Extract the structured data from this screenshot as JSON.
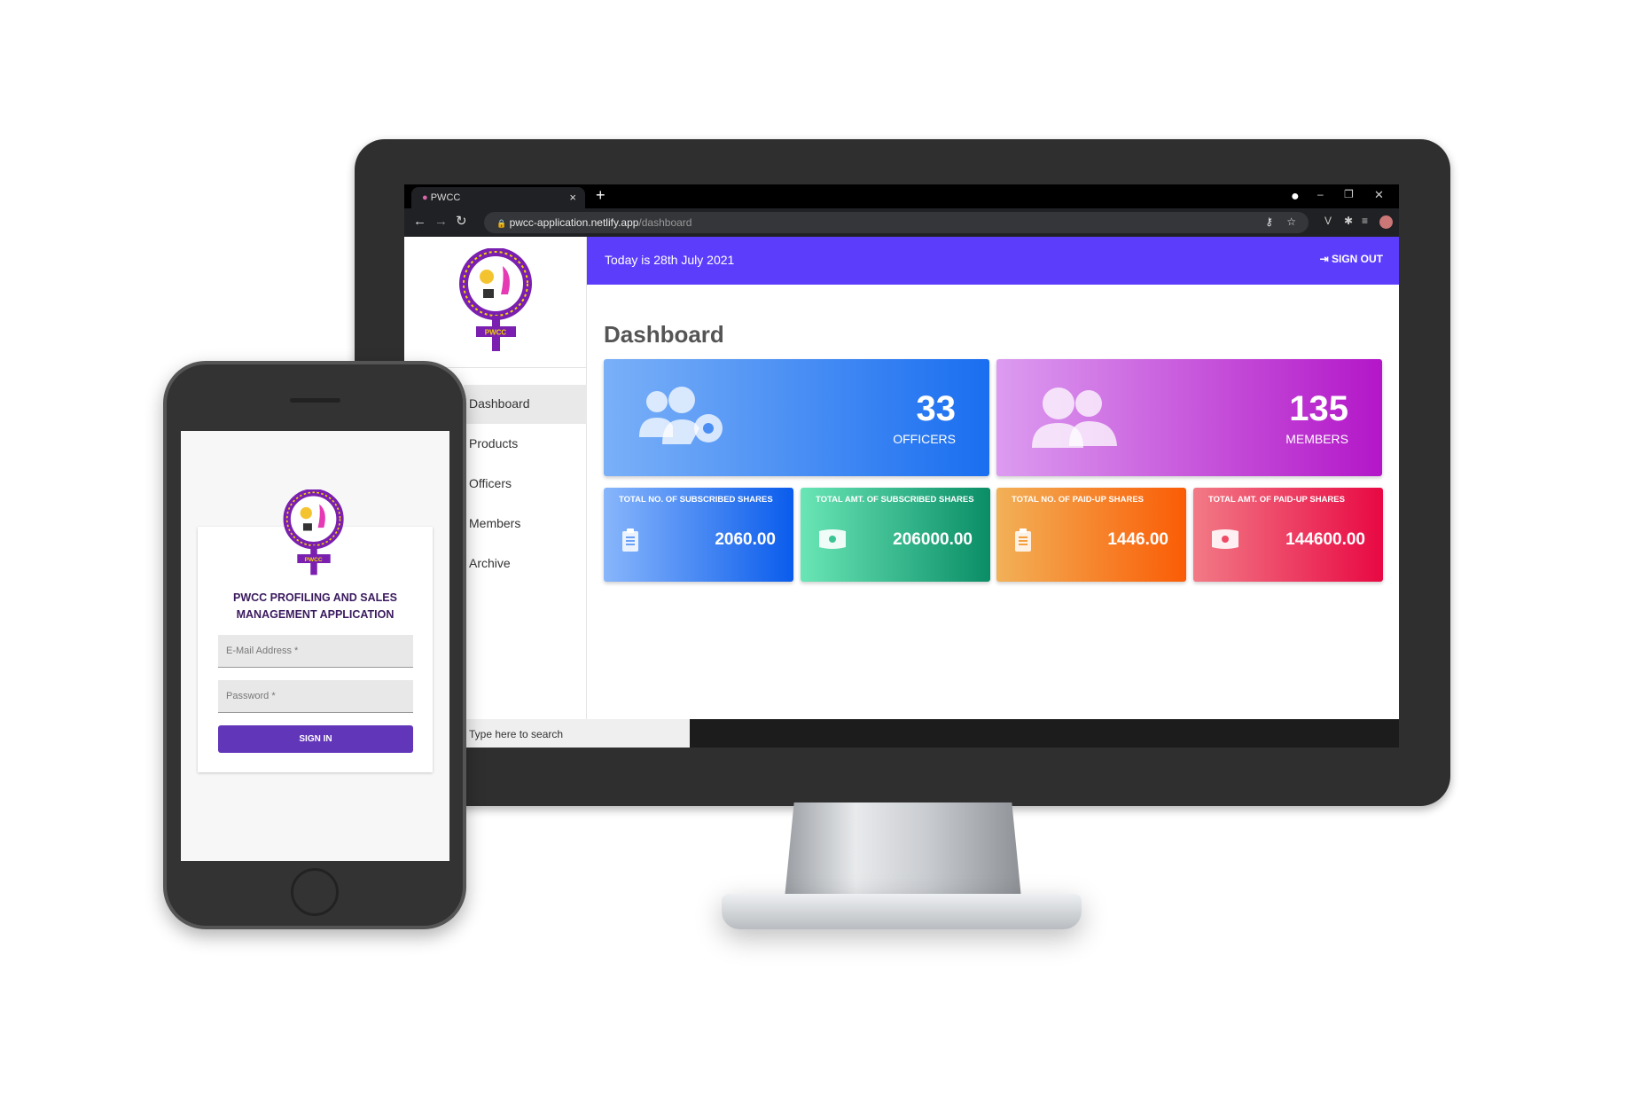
{
  "browser": {
    "tab_title": "PWCC",
    "new_tab": "+",
    "close": "×",
    "url_host": "pwcc-application.netlify.app",
    "url_path": "/dashboard",
    "window_controls": [
      "–",
      "❐",
      "✕"
    ]
  },
  "app": {
    "logo_text": "PWCC",
    "header": {
      "date": "Today is 28th July 2021",
      "sign_out": "SIGN OUT"
    },
    "sidebar": {
      "items": [
        {
          "label": "Dashboard",
          "active": true
        },
        {
          "label": "Products"
        },
        {
          "label": "Officers"
        },
        {
          "label": "Members"
        },
        {
          "label": "Archive"
        }
      ]
    },
    "page_title": "Dashboard",
    "summary": [
      {
        "value": "33",
        "label": "OFFICERS",
        "icon": "users-gear-icon",
        "colors": [
          "#7ab0f8",
          "#1a6ef0"
        ]
      },
      {
        "value": "135",
        "label": "MEMBERS",
        "icon": "users-icon",
        "colors": [
          "#dc9cf0",
          "#b316c8"
        ]
      }
    ],
    "stats": [
      {
        "label": "TOTAL NO. OF SUBSCRIBED SHARES",
        "value": "2060.00",
        "icon": "clipboard-icon",
        "colors": [
          "#88b6fb",
          "#0a5cec"
        ]
      },
      {
        "label": "TOTAL AMT. OF SUBSCRIBED SHARES",
        "value": "206000.00",
        "icon": "money-icon",
        "colors": [
          "#6ae6b6",
          "#0a8d66"
        ]
      },
      {
        "label": "TOTAL NO. OF PAID-UP SHARES",
        "value": "1446.00",
        "icon": "clipboard-icon",
        "colors": [
          "#f2b158",
          "#fa5c05"
        ]
      },
      {
        "label": "TOTAL AMT. OF PAID-UP SHARES",
        "value": "144600.00",
        "icon": "money-icon",
        "colors": [
          "#f27a86",
          "#e80843"
        ]
      }
    ],
    "taskbar_search": "Type here to search"
  },
  "phone": {
    "title_line1": "PWCC PROFILING AND SALES",
    "title_line2": "MANAGEMENT APPLICATION",
    "email_placeholder": "E-Mail Address *",
    "password_placeholder": "Password *",
    "sign_in": "SIGN IN"
  }
}
